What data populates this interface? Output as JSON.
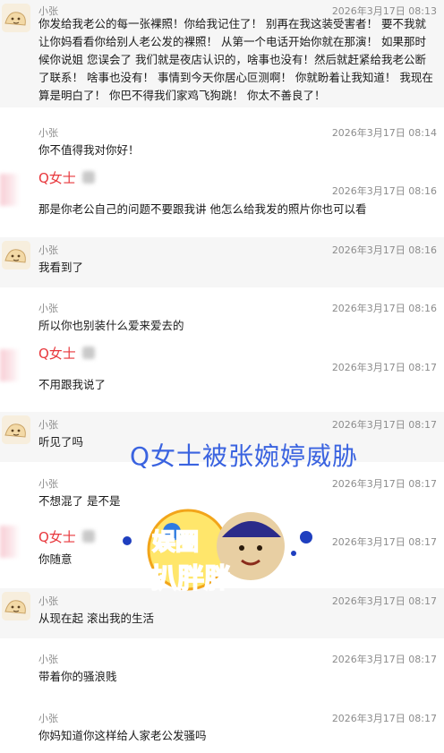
{
  "messages": [
    {
      "sender": "小张",
      "time": "2026年3月17日 08:13",
      "text": "你发给我老公的每一张裸照！你给我记住了！ 别再在我这装受害者！ 要不我就让你妈看看你给别人老公发的裸照！ 从第一个电话开始你就在那演！ 如果那时候你说姐 您误会了 我们就是夜店认识的，啥事也没有！然后就赶紧给我老公断了联系！ 啥事也没有！ 事情到今天你居心叵测啊！ 你就盼着让我知道！ 我现在算是明白了！ 你巴不得我们家鸡飞狗跳！ 你太不善良了！"
    },
    {
      "sender": "小张",
      "time": "2026年3月17日 08:14",
      "text": "你不值得我对你好！"
    },
    {
      "sender": "Q女士",
      "time": "2026年3月17日 08:16",
      "text": "那是你老公自己的问题不要跟我讲 他怎么给我发的照片你也可以看"
    },
    {
      "sender": "小张",
      "time": "2026年3月17日 08:16",
      "text": "我看到了"
    },
    {
      "sender": "小张",
      "time": "2026年3月17日 08:16",
      "text": "所以你也别装什么爱来爱去的"
    },
    {
      "sender": "Q女士",
      "time": "2026年3月17日 08:17",
      "text": "不用跟我说了"
    },
    {
      "sender": "小张",
      "time": "2026年3月17日 08:17",
      "text": "听见了吗"
    },
    {
      "sender": "小张",
      "time": "2026年3月17日 08:17",
      "text": "不想混了 是不是"
    },
    {
      "sender": "Q女士",
      "time": "2026年3月17日 08:17",
      "text": "你随意"
    },
    {
      "sender": "小张",
      "time": "2026年3月17日 08:17",
      "text": "从现在起 滚出我的生活"
    },
    {
      "sender": "小张",
      "time": "2026年3月17日 08:17",
      "text": "带着你的骚浪贱"
    },
    {
      "sender": "小张",
      "time": "2026年3月17日 08:17",
      "text": "你妈知道你这样给人家老公发骚吗"
    }
  ],
  "overlay": {
    "caption": "Q女士被张婉婷威胁",
    "watermark_line1": "娱圈",
    "watermark_line2": "扒胖胖",
    "caption_color": "#3a63e0",
    "watermark_color": "#7a4cc9"
  },
  "colors": {
    "sender_gray": "#8c8c8c",
    "q_sender_red": "#e8383d",
    "shaded_row": "#f6f6f6"
  }
}
